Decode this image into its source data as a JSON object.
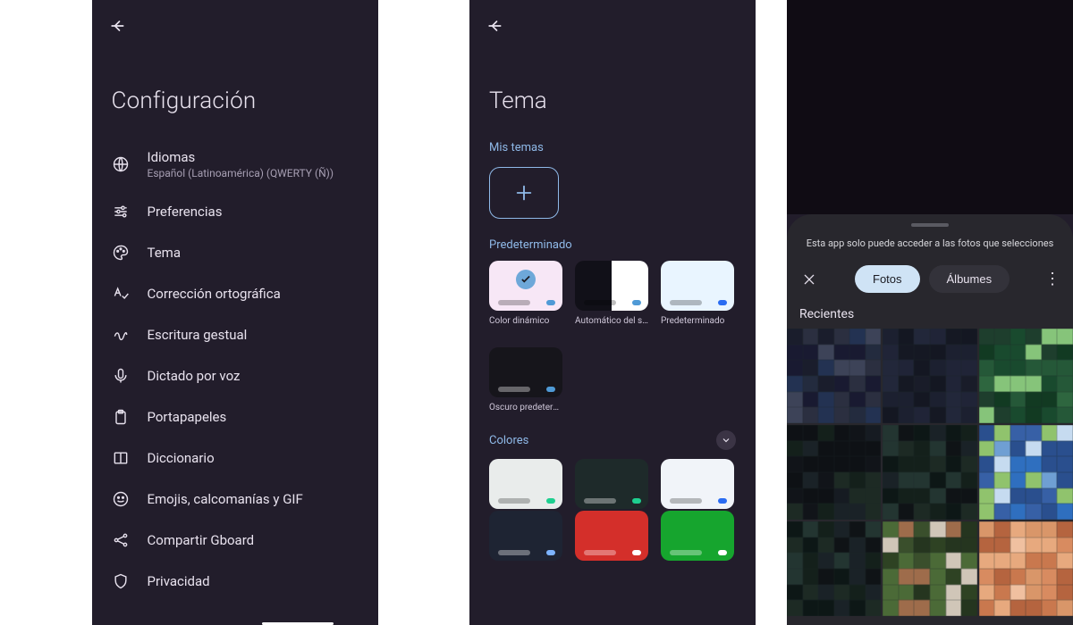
{
  "panel1": {
    "title": "Configuración",
    "items": [
      {
        "label": "Idiomas",
        "sub": "Español (Latinoamérica) (QWERTY (Ñ))",
        "icon": "globe-icon"
      },
      {
        "label": "Preferencias",
        "icon": "sliders-icon"
      },
      {
        "label": "Tema",
        "icon": "palette-icon"
      },
      {
        "label": "Corrección ortográfica",
        "icon": "spellcheck-icon"
      },
      {
        "label": "Escritura gestual",
        "icon": "gesture-icon"
      },
      {
        "label": "Dictado por voz",
        "icon": "mic-icon"
      },
      {
        "label": "Portapapeles",
        "icon": "clipboard-icon"
      },
      {
        "label": "Diccionario",
        "icon": "book-icon"
      },
      {
        "label": "Emojis, calcomanías y GIF",
        "icon": "emoji-icon"
      },
      {
        "label": "Compartir Gboard",
        "icon": "share-icon"
      },
      {
        "label": "Privacidad",
        "icon": "shield-icon"
      }
    ]
  },
  "panel2": {
    "title": "Tema",
    "sections": {
      "my_themes": "Mis temas",
      "default": "Predeterminado",
      "colors": "Colores"
    },
    "default_themes": [
      {
        "label": "Color dinámico",
        "bg": "#f7e7f6",
        "dot": "#4f9ad6",
        "selected": true
      },
      {
        "label": "Automático del sistema",
        "bg_split": [
          "#111018",
          "#ffffff"
        ],
        "dot": "#4f9ad6"
      },
      {
        "label": "Predeterminado",
        "bg": "#e9f5ff",
        "dot": "#2a6cf2"
      },
      {
        "label": "Oscuro predeterminado",
        "bg": "#16151b",
        "dot": "#4f9ad6"
      }
    ],
    "color_themes_row1": [
      {
        "bg": "#e9eceb",
        "dot": "#1ecf8f"
      },
      {
        "bg": "#1e2a2a",
        "dot": "#1ecf8f"
      },
      {
        "bg": "#f1f4f9",
        "dot": "#2a6cf2"
      }
    ],
    "color_themes_row2": [
      {
        "bg": "#1e2433",
        "dot": "#7db4ff"
      },
      {
        "bg": "#d42f2a",
        "dot": "#ffffff"
      },
      {
        "bg": "#16a52e",
        "dot": "#ffffff"
      }
    ]
  },
  "panel3": {
    "msg": "Esta app solo puede acceder a las fotos que selecciones",
    "tabs": {
      "photos": "Fotos",
      "albums": "Álbumes"
    },
    "active_tab": "photos",
    "section_label": "Recientes",
    "thumb_colors": [
      [
        "#191a31",
        "#3d4358",
        "#233252",
        "#2b2f40",
        "#1a1d2c",
        "#232b3e"
      ],
      [
        "#141722",
        "#1c2030",
        "#202437",
        "#191c29",
        "#22273a",
        "#151823"
      ],
      [
        "#1e3e2d",
        "#2e663f",
        "#194a2e",
        "#255838",
        "#86c47a",
        "#123a22"
      ],
      [
        "#161b22",
        "#111419",
        "#1a2227",
        "#1d2a24",
        "#0e1115",
        "#14201b"
      ],
      [
        "#1a2227",
        "#0f1316",
        "#1d2a24",
        "#14201b",
        "#233531",
        "#0d1716"
      ],
      [
        "#2f6fbf",
        "#3760a6",
        "#90c36d",
        "#c6dbf0",
        "#6f9fd3",
        "#2a4f8e"
      ],
      [
        "#1a2227",
        "#0f1316",
        "#1d2a24",
        "#14201b",
        "#233531",
        "#0d1716"
      ],
      [
        "#25351f",
        "#3a4f2c",
        "#9e6c4b",
        "#4b6a37",
        "#2e4223",
        "#d0c6b8"
      ],
      [
        "#d88b60",
        "#c9784e",
        "#e7a97e",
        "#b5643f",
        "#d99669",
        "#f0c0a0"
      ]
    ]
  }
}
